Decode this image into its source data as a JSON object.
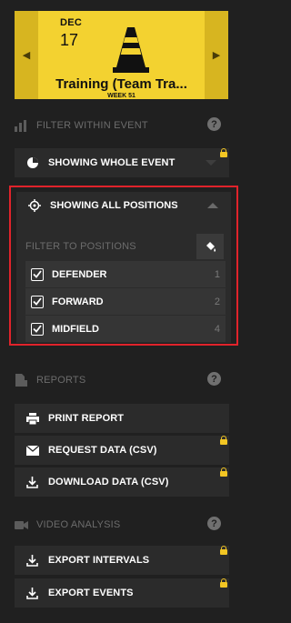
{
  "event": {
    "month": "DEC",
    "day": "17",
    "title": "Training (Team Tra...",
    "week": "WEEK 51"
  },
  "filter_section": {
    "label": "FILTER WITHIN EVENT",
    "help": "?"
  },
  "whole_event": {
    "label": "SHOWING WHOLE EVENT"
  },
  "positions": {
    "label": "SHOWING ALL POSITIONS",
    "filter_label": "FILTER TO POSITIONS",
    "items": [
      {
        "name": "DEFENDER",
        "count": "1",
        "checked": true
      },
      {
        "name": "FORWARD",
        "count": "2",
        "checked": true
      },
      {
        "name": "MIDFIELD",
        "count": "4",
        "checked": true
      }
    ]
  },
  "reports_section": {
    "label": "REPORTS",
    "help": "?",
    "items": [
      {
        "label": "PRINT REPORT",
        "icon": "printer-icon",
        "locked": false
      },
      {
        "label": "REQUEST DATA (CSV)",
        "icon": "envelope-icon",
        "locked": true
      },
      {
        "label": "DOWNLOAD DATA (CSV)",
        "icon": "download-icon",
        "locked": true
      }
    ]
  },
  "video_section": {
    "label": "VIDEO ANALYSIS",
    "help": "?",
    "items": [
      {
        "label": "EXPORT INTERVALS",
        "icon": "download-icon",
        "locked": true
      },
      {
        "label": "EXPORT EVENTS",
        "icon": "download-icon",
        "locked": true
      }
    ]
  },
  "colors": {
    "background": "#202020",
    "row": "#2b2b2b",
    "accent_yellow": "#f3d230",
    "highlight_red": "#e0232b"
  }
}
